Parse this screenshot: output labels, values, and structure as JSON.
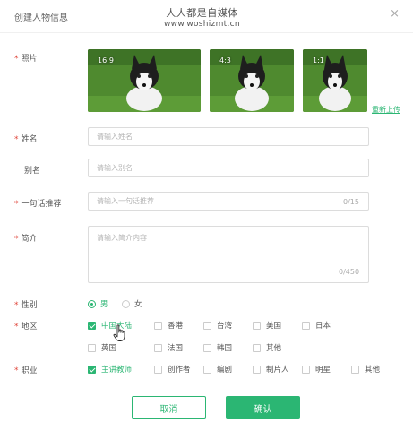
{
  "dialog": {
    "title": "创建人物信息",
    "close_symbol": "×",
    "watermark_line1": "人人都是自媒体",
    "watermark_line2": "www.woshizmt.cn"
  },
  "required_mark": "*",
  "photo": {
    "label": "照片",
    "items": [
      {
        "ratio": "16:9"
      },
      {
        "ratio": "4:3"
      },
      {
        "ratio": "1:1"
      }
    ],
    "reupload": "重新上传"
  },
  "name": {
    "label": "姓名",
    "placeholder": "请输入姓名",
    "value": ""
  },
  "alias": {
    "label": "别名",
    "placeholder": "请输入别名",
    "value": ""
  },
  "tagline": {
    "label": "一句话推荐",
    "placeholder": "请输入一句话推荐",
    "value": "",
    "counter": "0/15"
  },
  "intro": {
    "label": "简介",
    "placeholder": "请输入简介内容",
    "value": "",
    "counter": "0/450"
  },
  "gender": {
    "label": "性别",
    "options": [
      {
        "label": "男",
        "selected": true
      },
      {
        "label": "女",
        "selected": false
      }
    ]
  },
  "region": {
    "label": "地区",
    "options": [
      {
        "label": "中国大陆",
        "checked": true
      },
      {
        "label": "香港",
        "checked": false
      },
      {
        "label": "台湾",
        "checked": false
      },
      {
        "label": "美国",
        "checked": false
      },
      {
        "label": "日本",
        "checked": false
      },
      {
        "label": "英国",
        "checked": false
      },
      {
        "label": "法国",
        "checked": false
      },
      {
        "label": "韩国",
        "checked": false
      },
      {
        "label": "其他",
        "checked": false
      }
    ]
  },
  "occupation": {
    "label": "职业",
    "options": [
      {
        "label": "主讲教师",
        "checked": true
      },
      {
        "label": "创作者",
        "checked": false
      },
      {
        "label": "编剧",
        "checked": false
      },
      {
        "label": "制片人",
        "checked": false
      },
      {
        "label": "明星",
        "checked": false
      },
      {
        "label": "其他",
        "checked": false
      }
    ]
  },
  "buttons": {
    "cancel": "取消",
    "confirm": "确认"
  },
  "colors": {
    "accent": "#2bb673",
    "required": "#e0463b",
    "border": "#dcdcdc"
  },
  "icons": {
    "close": "close-icon",
    "cursor": "hand-pointer-icon",
    "photo": "husky-puppy-photo"
  }
}
